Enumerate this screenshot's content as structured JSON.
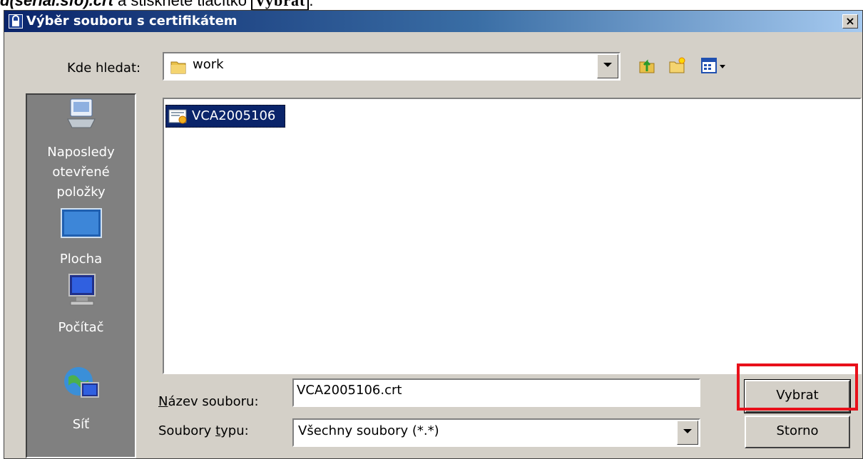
{
  "doc": {
    "filename_fragment": "d(serial.sfo).crt",
    "middle_text": " a stiskněte tlačítko ",
    "button_ref": "Vybrat",
    "tail": "."
  },
  "dialog": {
    "title": "Výběr souboru s certifikátem",
    "close_label": "×",
    "look_in_label": "Kde hledat:",
    "look_in_value": "work",
    "places": [
      {
        "label": "Naposledy otevřené položky",
        "icon": "recent-items-icon"
      },
      {
        "label": "Plocha",
        "icon": "desktop-icon"
      },
      {
        "label": "Počítač",
        "icon": "computer-icon"
      },
      {
        "label": "Síť",
        "icon": "network-icon"
      }
    ],
    "files": [
      {
        "name": "VCA2005106",
        "icon": "certificate-icon",
        "selected": true
      }
    ],
    "filename_label_pre": "N",
    "filename_label_post": "ázev souboru:",
    "filename_value": "VCA2005106.crt",
    "filetype_label_pre": "Soubory ",
    "filetype_label_u": "t",
    "filetype_label_post": "ypu:",
    "filetype_value": "Všechny soubory (*.*)",
    "ok_button": "Vybrat",
    "cancel_button": "Storno"
  },
  "colors": {
    "title_gradient_start": "#0a246a",
    "title_gradient_end": "#a6caf0",
    "dialog_bg": "#d4d0c8",
    "places_bg": "#808080",
    "selection_bg": "#0a246a",
    "highlight_border": "#e8101a"
  }
}
